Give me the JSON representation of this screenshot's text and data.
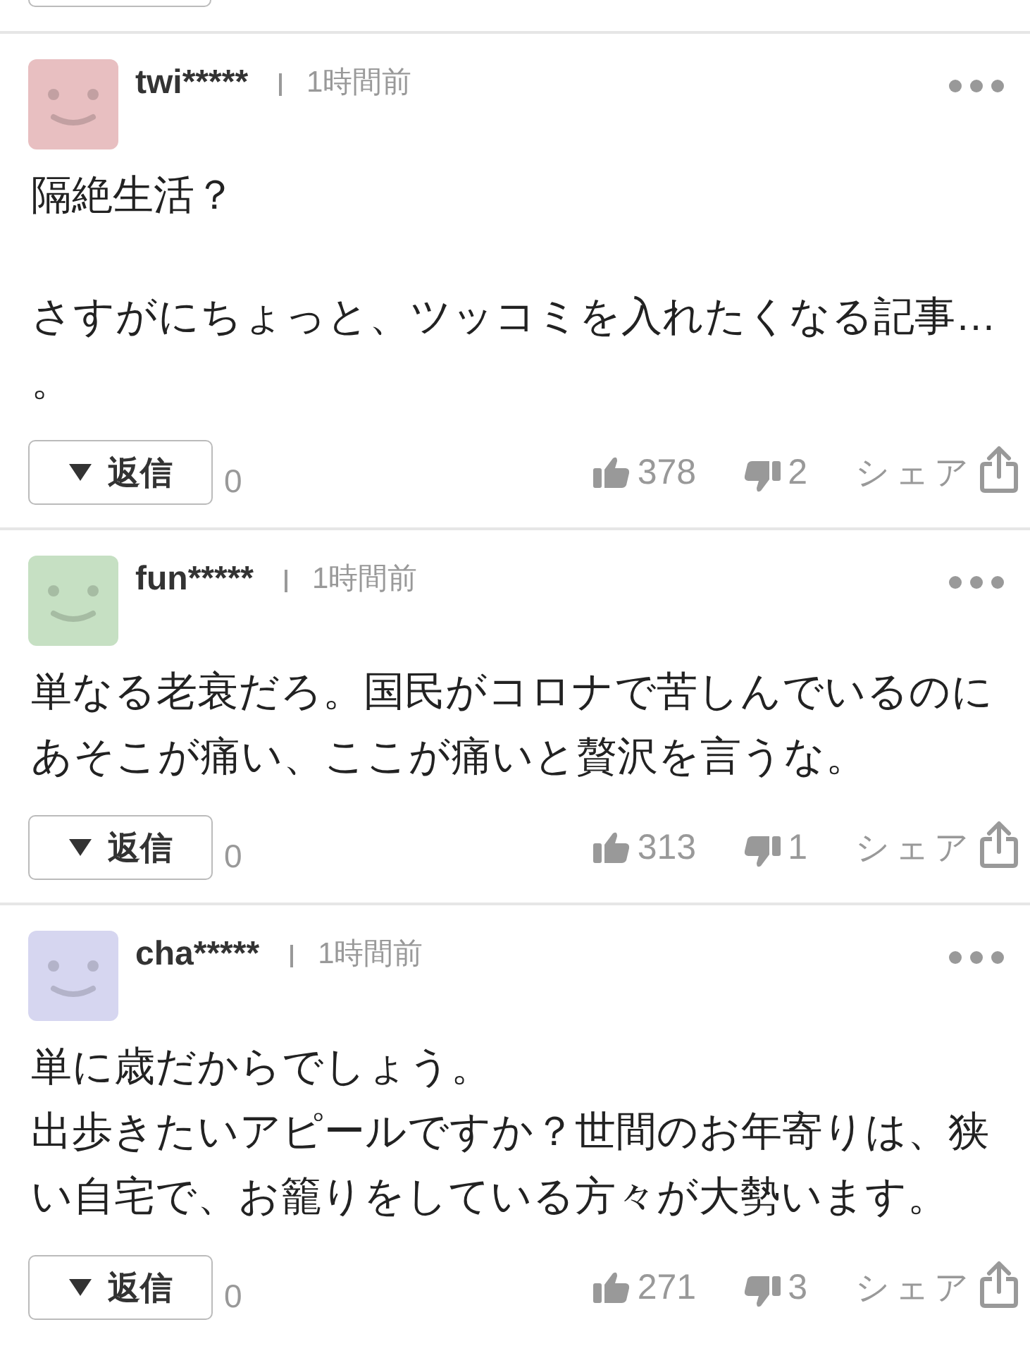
{
  "comments": [
    {
      "user": "twi*****",
      "time": "1時間前",
      "color": "#e8bfc1",
      "paragraphs": [
        [
          "隔絶生活？"
        ],
        [
          "さすがにちょっと、ツッコミを入れたくなる記事…",
          "。"
        ]
      ],
      "reply_label": "返信",
      "reply_count": "0",
      "likes": "378",
      "dislikes": "2",
      "share_label": "シェア"
    },
    {
      "user": "fun*****",
      "time": "1時間前",
      "color": "#c6e0c3",
      "paragraphs": [
        [
          "単なる老衰だろ。国民がコロナで苦しんでいるのに",
          "あそこが痛い、ここが痛いと贅沢を言うな。"
        ]
      ],
      "reply_label": "返信",
      "reply_count": "0",
      "likes": "313",
      "dislikes": "1",
      "share_label": "シェア"
    },
    {
      "user": "cha*****",
      "time": "1時間前",
      "color": "#d6d6f0",
      "paragraphs": [
        [
          "単に歳だからでしょう。",
          "出歩きたいアピールですか？世間のお年寄りは、狭",
          "い自宅で、お籠りをしている方々が大勢います。"
        ]
      ],
      "reply_label": "返信",
      "reply_count": "0",
      "likes": "271",
      "dislikes": "3",
      "share_label": "シェア"
    }
  ]
}
